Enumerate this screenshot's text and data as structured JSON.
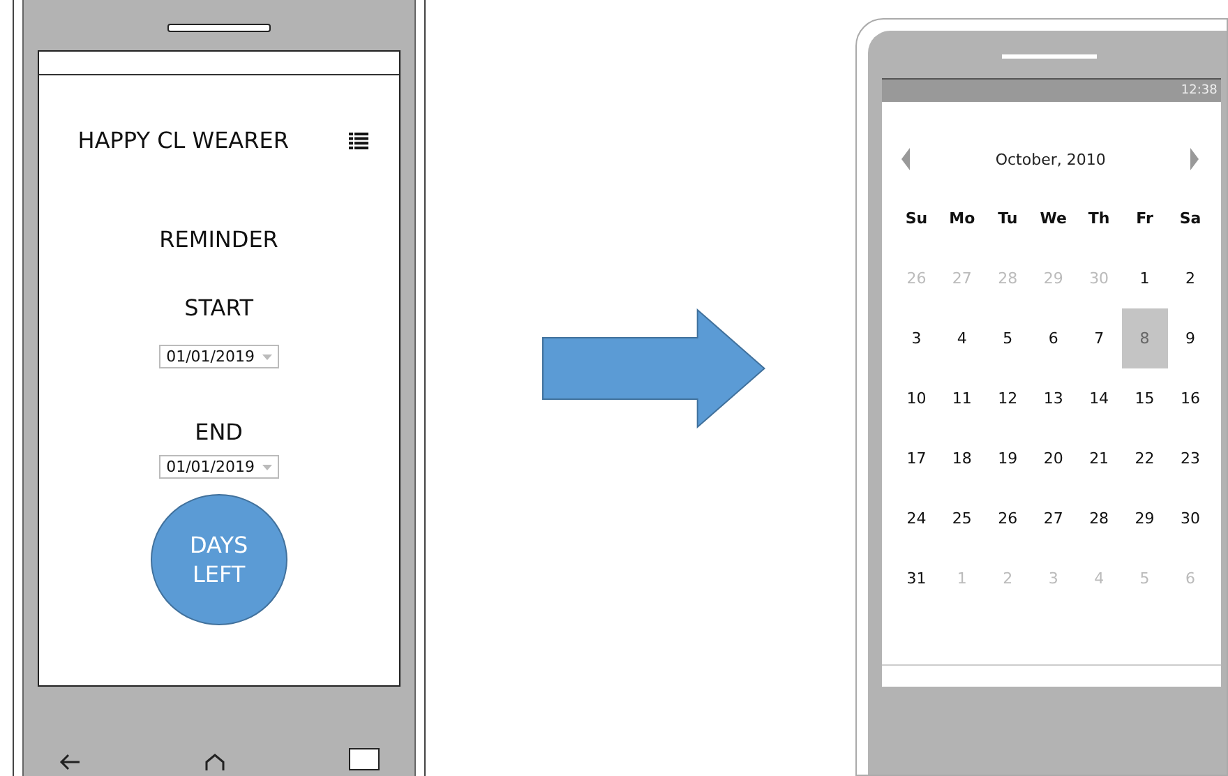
{
  "left_phone": {
    "title": "HAPPY CL WEARER",
    "reminder_label": "REMINDER",
    "start_label": "START",
    "start_date": "01/01/2019",
    "end_label": "END",
    "end_date": "01/01/2019",
    "days_left_button": "DAYS LEFT"
  },
  "right_phone": {
    "status_time": "12:38",
    "month": "October, 2010",
    "weekdays": [
      "Su",
      "Mo",
      "Tu",
      "We",
      "Th",
      "Fr",
      "Sa"
    ],
    "days": [
      {
        "label": "26",
        "outside": true,
        "selected": false
      },
      {
        "label": "27",
        "outside": true,
        "selected": false
      },
      {
        "label": "28",
        "outside": true,
        "selected": false
      },
      {
        "label": "29",
        "outside": true,
        "selected": false
      },
      {
        "label": "30",
        "outside": true,
        "selected": false
      },
      {
        "label": "1",
        "outside": false,
        "selected": false
      },
      {
        "label": "2",
        "outside": false,
        "selected": false
      },
      {
        "label": "3",
        "outside": false,
        "selected": false
      },
      {
        "label": "4",
        "outside": false,
        "selected": false
      },
      {
        "label": "5",
        "outside": false,
        "selected": false
      },
      {
        "label": "6",
        "outside": false,
        "selected": false
      },
      {
        "label": "7",
        "outside": false,
        "selected": false
      },
      {
        "label": "8",
        "outside": false,
        "selected": true
      },
      {
        "label": "9",
        "outside": false,
        "selected": false
      },
      {
        "label": "10",
        "outside": false,
        "selected": false
      },
      {
        "label": "11",
        "outside": false,
        "selected": false
      },
      {
        "label": "12",
        "outside": false,
        "selected": false
      },
      {
        "label": "13",
        "outside": false,
        "selected": false
      },
      {
        "label": "14",
        "outside": false,
        "selected": false
      },
      {
        "label": "15",
        "outside": false,
        "selected": false
      },
      {
        "label": "16",
        "outside": false,
        "selected": false
      },
      {
        "label": "17",
        "outside": false,
        "selected": false
      },
      {
        "label": "18",
        "outside": false,
        "selected": false
      },
      {
        "label": "19",
        "outside": false,
        "selected": false
      },
      {
        "label": "20",
        "outside": false,
        "selected": false
      },
      {
        "label": "21",
        "outside": false,
        "selected": false
      },
      {
        "label": "22",
        "outside": false,
        "selected": false
      },
      {
        "label": "23",
        "outside": false,
        "selected": false
      },
      {
        "label": "24",
        "outside": false,
        "selected": false
      },
      {
        "label": "25",
        "outside": false,
        "selected": false
      },
      {
        "label": "26",
        "outside": false,
        "selected": false
      },
      {
        "label": "27",
        "outside": false,
        "selected": false
      },
      {
        "label": "28",
        "outside": false,
        "selected": false
      },
      {
        "label": "29",
        "outside": false,
        "selected": false
      },
      {
        "label": "30",
        "outside": false,
        "selected": false
      },
      {
        "label": "31",
        "outside": false,
        "selected": false
      },
      {
        "label": "1",
        "outside": true,
        "selected": false
      },
      {
        "label": "2",
        "outside": true,
        "selected": false
      },
      {
        "label": "3",
        "outside": true,
        "selected": false
      },
      {
        "label": "4",
        "outside": true,
        "selected": false
      },
      {
        "label": "5",
        "outside": true,
        "selected": false
      },
      {
        "label": "6",
        "outside": true,
        "selected": false
      }
    ]
  }
}
